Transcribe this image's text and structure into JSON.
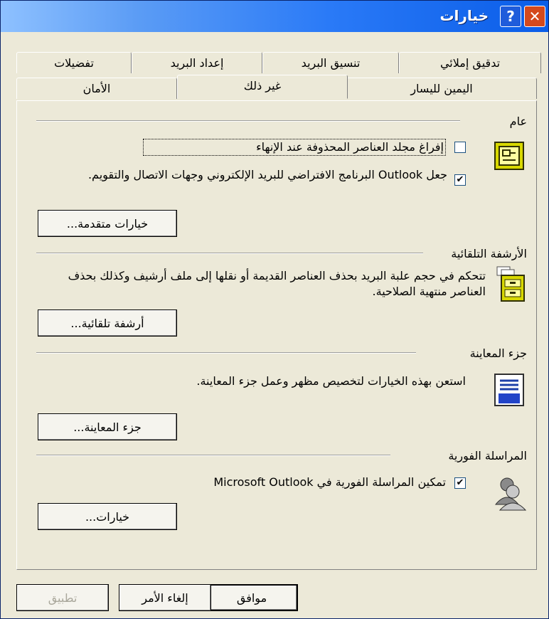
{
  "window": {
    "title": "خيارات",
    "close_icon": "✕",
    "help_icon": "?"
  },
  "tabs_row1": [
    "تدقيق إملائي",
    "تنسيق البريد",
    "إعداد البريد",
    "تفضيلات"
  ],
  "tabs_row2": [
    "اليمين لليسار",
    "غير ذلك",
    "الأمان"
  ],
  "active_tab": "غير ذلك",
  "general": {
    "title": "عام",
    "empty_deleted_label": "إفراغ مجلد العناصر المحذوفة عند الإنهاء",
    "empty_deleted_checked": false,
    "default_program_label": "جعل Outlook البرنامج الافتراضي للبريد الإلكتروني وجهات الاتصال والتقويم.",
    "default_program_checked": true,
    "advanced_button": "خيارات متقدمة..."
  },
  "autoarchive": {
    "title": "الأرشفة التلقائية",
    "description": "تتحكم في حجم علبة البريد بحذف العناصر القديمة أو نقلها إلى ملف أرشيف  وكذلك بحذف العناصر منتهية الصلاحية.",
    "button": "أرشفة تلقائية..."
  },
  "preview": {
    "title": "جزء المعاينة",
    "description": "استعن بهذه الخيارات لتخصيص مظهر وعمل جزء المعاينة.",
    "button": "جزء المعاينة..."
  },
  "im": {
    "title": "المراسلة الفورية",
    "enable_label": "تمكين المراسلة الفورية في Microsoft Outlook",
    "enable_checked": true,
    "button": "خيارات..."
  },
  "footer": {
    "ok": "موافق",
    "cancel": "إلغاء الأمر",
    "apply": "تطبيق"
  }
}
